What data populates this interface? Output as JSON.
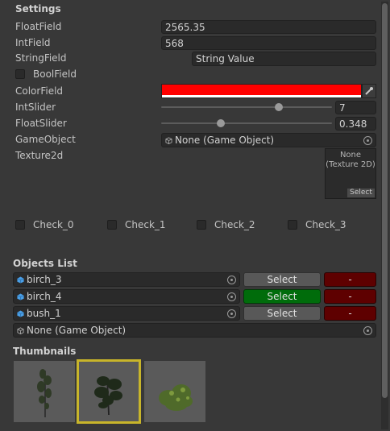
{
  "settings": {
    "header": "Settings",
    "float_field": {
      "label": "FloatField",
      "value": "2565.35"
    },
    "int_field": {
      "label": "IntField",
      "value": "568"
    },
    "string_field": {
      "label": "StringField",
      "value": "String Value"
    },
    "bool_field": {
      "label": "BoolField",
      "checked": false
    },
    "color_field": {
      "label": "ColorField",
      "color": "#ff0000"
    },
    "int_slider": {
      "label": "IntSlider",
      "value": "7",
      "fraction": 0.69
    },
    "float_slider": {
      "label": "FloatSlider",
      "value": "0.348",
      "fraction": 0.348
    },
    "game_object": {
      "label": "GameObject",
      "value": "None (Game Object)"
    },
    "texture2d": {
      "label": "Texture2d",
      "preview": "None\n(Texture 2D)",
      "select": "Select"
    }
  },
  "checks": [
    "Check_0",
    "Check_1",
    "Check_2",
    "Check_3"
  ],
  "objects_list": {
    "header": "Objects List",
    "items": [
      {
        "name": "birch_3",
        "select": "Select",
        "remove": "-",
        "selected": false
      },
      {
        "name": "birch_4",
        "select": "Select",
        "remove": "-",
        "selected": true
      },
      {
        "name": "bush_1",
        "select": "Select",
        "remove": "-",
        "selected": false
      }
    ],
    "empty_slot": "None (Game Object)"
  },
  "thumbnails": {
    "header": "Thumbnails",
    "items": [
      {
        "icon": "birch-tree-icon",
        "selected": false
      },
      {
        "icon": "birch-tree-icon",
        "selected": true
      },
      {
        "icon": "bush-icon",
        "selected": false
      }
    ]
  },
  "colors": {
    "select_active": "#006c0b",
    "remove_button": "#5e0000",
    "thumbnail_highlight": "#c8b52a"
  }
}
